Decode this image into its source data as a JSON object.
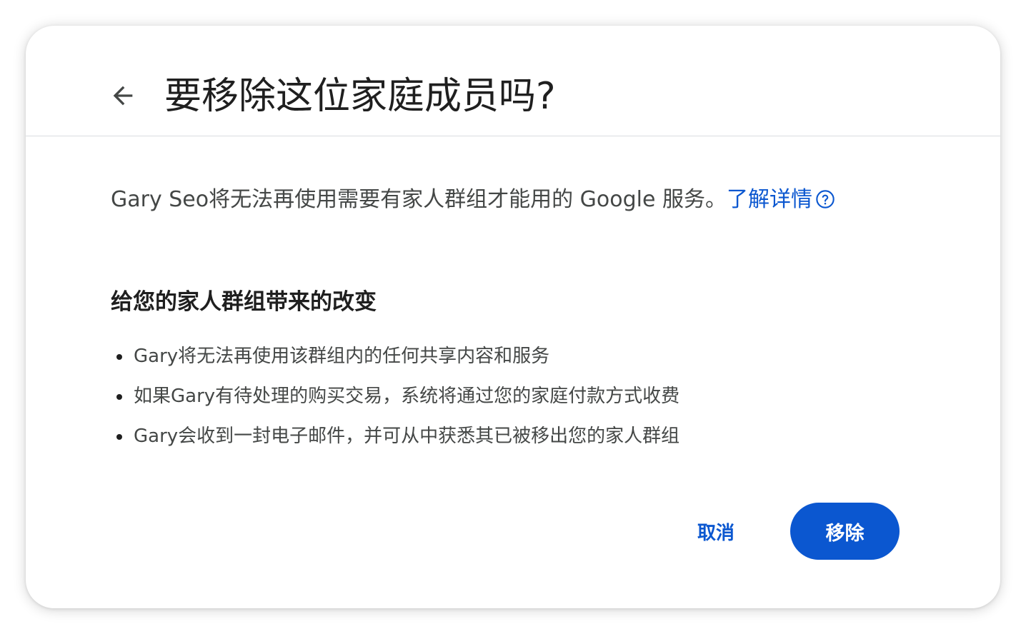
{
  "dialog": {
    "title": "要移除这位家庭成员吗?",
    "description": "Gary Seo将无法再使用需要有家人群组才能用的 Google 服务。",
    "learn_more": "了解详情",
    "section_title": "给您的家人群组带来的改变",
    "changes": [
      "Gary将无法再使用该群组内的任何共享内容和服务",
      "如果Gary有待处理的购买交易，系统将通过您的家庭付款方式收费",
      "Gary会收到一封电子邮件，并可从中获悉其已被移出您的家人群组"
    ],
    "cancel_label": "取消",
    "remove_label": "移除"
  },
  "icons": {
    "back": "arrow-back-icon",
    "help": "help-circle-icon"
  },
  "colors": {
    "accent": "#0b57d0",
    "text_primary": "#1f1f1f",
    "text_secondary": "#444746",
    "divider": "#dadce0"
  }
}
